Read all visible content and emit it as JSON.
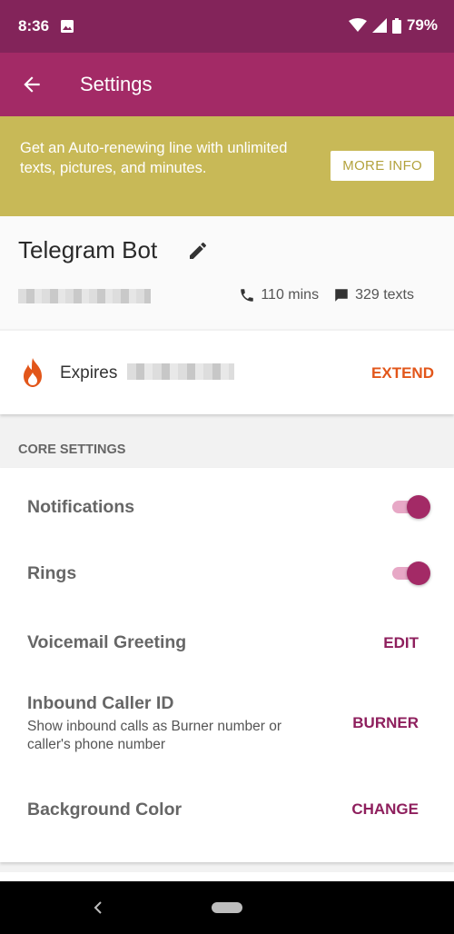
{
  "status_bar": {
    "time": "8:36",
    "battery": "79%"
  },
  "app_bar": {
    "title": "Settings",
    "back_icon": "arrow-left-icon"
  },
  "promo": {
    "text": "Get an Auto-renewing line with unlimited texts, pictures, and minutes.",
    "button_label": "MORE INFO"
  },
  "line": {
    "name": "Telegram Bot",
    "minutes": "110 mins",
    "texts": "329 texts"
  },
  "expiry": {
    "label": "Expires",
    "action": "EXTEND"
  },
  "section": {
    "header": "CORE SETTINGS"
  },
  "settings": {
    "notifications": {
      "label": "Notifications",
      "on": true
    },
    "rings": {
      "label": "Rings",
      "on": true
    },
    "voicemail": {
      "label": "Voicemail Greeting",
      "action": "EDIT"
    },
    "caller_id": {
      "label": "Inbound Caller ID",
      "sub": "Show inbound calls as Burner number or caller's phone number",
      "action": "BURNER"
    },
    "background": {
      "label": "Background Color",
      "action": "CHANGE"
    }
  },
  "colors": {
    "status_bar": "#83245a",
    "app_bar": "#a32a66",
    "promo": "#c8b957",
    "accent": "#8e1f5d",
    "extend": "#e2561a"
  }
}
